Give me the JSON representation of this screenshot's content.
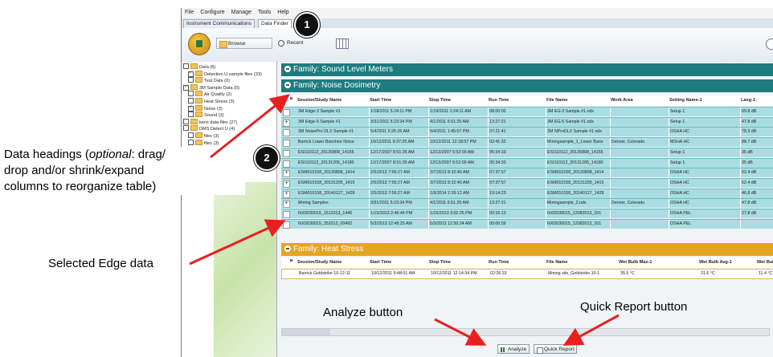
{
  "menu": [
    "File",
    "Configure",
    "Manage",
    "Tools",
    "Help"
  ],
  "tabs": [
    "Instrument Communications",
    "Data Finder"
  ],
  "toolbar": {
    "browse": "Browse",
    "recent": "Recent"
  },
  "tree": [
    {
      "label": "Data (6)",
      "checked": false,
      "level": 0
    },
    {
      "label": "Detection U sample files (33)",
      "checked": true,
      "level": 1
    },
    {
      "label": "Test Data (0)",
      "checked": false,
      "level": 1
    },
    {
      "label": "3M Sample Data (0)",
      "checked": true,
      "level": 0
    },
    {
      "label": "Air Quality (2)",
      "checked": false,
      "level": 1
    },
    {
      "label": "Heat Stress (3)",
      "checked": false,
      "level": 1
    },
    {
      "label": "Noise (3)",
      "checked": true,
      "level": 1
    },
    {
      "label": "Sound (3)",
      "checked": false,
      "level": 1
    },
    {
      "label": "kens data files (27)",
      "checked": false,
      "level": 0
    },
    {
      "label": "DMS Detect U (4)",
      "checked": false,
      "level": 0
    },
    {
      "label": "files (3)",
      "checked": false,
      "level": 1
    },
    {
      "label": "files (3)",
      "checked": false,
      "level": 1
    }
  ],
  "families": {
    "sound": "Family: Sound Level Meters",
    "noise": "Family: Noise Dosimetry",
    "heat": "Family: Heat Stress"
  },
  "noise_columns": [
    "Session/Study Name",
    "Start Time",
    "Stop Time",
    "Run Time",
    "File Name",
    "Work Area",
    "Setting Name-1",
    "Lavg-1"
  ],
  "noise_rows": [
    [
      "",
      "3M Edge-3 Sample #1",
      "1/18/2011 5:24:11 PM",
      "1/19/2011 1:24:11 AM",
      "08:00:00",
      "3M EG-3 Sample #1.ndx",
      "",
      "Setup 1",
      "99.8 dB"
    ],
    [
      "+",
      "3M Edge-5 Sample #1",
      "3/31/2011 5:23:34 PM",
      "4/1/2011 6:51:25 AM",
      "13:27:21",
      "3M EG-5 Sample #1.ndx",
      "",
      "Setup 1",
      "47.8 dB"
    ],
    [
      "",
      "3M NoisePro DLX Sample #1",
      "5/4/2011 6:25:26 AM",
      "5/4/2011 1:45:07 PM",
      "07:21:41",
      "3M NProDLX Sample #1.ndx",
      "",
      "OSHA HC",
      "78.3 dB"
    ],
    [
      "",
      "Barrick Lower Banshee Noise",
      "10/12/2011 9:37:25 AM",
      "10/12/2011 12:18:57 PM",
      "02:41:32",
      "Miningsample_1_Lower Bans",
      "Denver, Colorado",
      "MSHA HC",
      "88.7 dB"
    ],
    [
      "",
      "ESI110112_20130808_14155",
      "12/17/2007 8:51:35 AM",
      "12/13/2007 5:52:09 AM",
      "05:34:33",
      "ESI110112_20130808_14155",
      "",
      "Setup 1",
      "35 dB"
    ],
    [
      "",
      "ESI110112_20131205_14180",
      "12/17/2007 8:51:35 AM",
      "12/13/2007 5:52:09 AM",
      "05:34:33",
      "ESI110112_20131205_14180",
      "",
      "Setup 1",
      "35 dB"
    ],
    [
      "+",
      "ESM010158_20130808_1414",
      "2/5/2013 7:56:27 AM",
      "3/7/2013 8:32:40 AM",
      "07:37:57",
      "ESM010158_20130808_1414",
      "",
      "OSHA HC",
      "52.4 dB"
    ],
    [
      "+",
      "ESM010158_20131205_1415",
      "2/5/2013 7:56:27 AM",
      "3/7/2013 8:32:40 AM",
      "07:37:57",
      "ESM010158_20131205_1415",
      "",
      "OSHA HC",
      "52.4 dB"
    ],
    [
      "+",
      "ESM010158_20140127_1428",
      "2/5/2013 7:56:27 AM",
      "1/9/2014 2:39:12 AM",
      "19:14:23",
      "ESM010158_20140127_1428",
      "",
      "OSHA HC",
      "46.8 dB"
    ],
    [
      "+",
      "Mining Samples",
      "3/31/2011 5:23:34 PM",
      "4/1/2011 6:51:25 AM",
      "13:27:21",
      "Miningsample_2.ndx",
      "Denver, Colorado",
      "OSHA HC",
      "47.8 dB"
    ],
    [
      "",
      "NXD030015_1512013_1446",
      "1/15/2013 2:46:44 PM",
      "1/15/2013 3:02:25 PM",
      "00:15:13",
      "NXD030015_12082013_101",
      "",
      "OSHA PEL",
      "27.8 dB"
    ],
    [
      "",
      "NXD030015_352013_00492",
      "5/3/2013 12:49:25 AM",
      "5/3/2013 12:50:24 AM",
      "00:00:59",
      "NXD030015_12082013_101",
      "",
      "OSHA PEL",
      ""
    ]
  ],
  "heat_columns": [
    "Session/Study Name",
    "Start Time",
    "Stop Time",
    "Run Time",
    "File Name",
    "Wet Bulb Max-1",
    "Wet Bulb Avg-1",
    "Wet Bulb M"
  ],
  "heat_rows": [
    [
      "Barrick Goldstrike 10-12-11",
      "10/12/2011 9:48:01 AM",
      "10/12/2011 12:14:34 PM",
      "02:26:33",
      "Mining site_Goldstrike 10-1",
      "35.5 °C",
      "21.6 °C",
      "11.4 °C"
    ]
  ],
  "bottom": {
    "analyze": "Analyze",
    "quick_report": "Quick Report"
  },
  "callouts": [
    "1",
    "2"
  ],
  "annotations": {
    "headings_pre": "Data headings (",
    "headings_italic": "optional",
    "headings_post": ":  drag/",
    "headings_line2": "drop and/or shrink/expand",
    "headings_line3": "columns to reorganize table)",
    "selected": "Selected Edge data",
    "analyze": "Analyze button",
    "quick_report": "Quick Report button"
  },
  "colors": {
    "teal": "#1e7c7f",
    "gold": "#e6a520",
    "selected_row": "#a9dde3",
    "arrow": "#e8201f"
  }
}
